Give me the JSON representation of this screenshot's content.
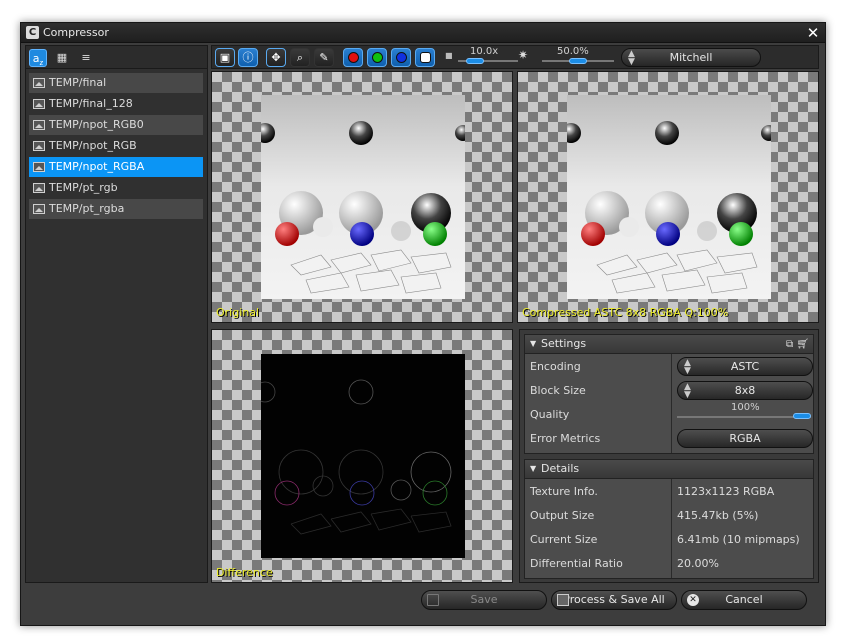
{
  "window": {
    "title": "Compressor",
    "app_icon": "app-icon",
    "close_icon": "close-icon"
  },
  "left_toolbar": {
    "icons": [
      "sort-alpha-icon",
      "calendar-icon",
      "filter-icon"
    ]
  },
  "files": [
    {
      "label": "TEMP/final",
      "selected": false
    },
    {
      "label": "TEMP/final_128",
      "selected": false
    },
    {
      "label": "TEMP/npot_RGB0",
      "selected": false
    },
    {
      "label": "TEMP/npot_RGB",
      "selected": false
    },
    {
      "label": "TEMP/npot_RGBA",
      "selected": true
    },
    {
      "label": "TEMP/pt_rgb",
      "selected": false
    },
    {
      "label": "TEMP/pt_rgba",
      "selected": false
    }
  ],
  "toolbar": {
    "zoom": {
      "label": "10.0x",
      "level": 0.2
    },
    "exposure": {
      "label": "50.0%",
      "level": 0.5
    },
    "filter": "Mitchell",
    "channel_colors": [
      "#e01010",
      "#10c010",
      "#1030e0",
      "#ffffff"
    ]
  },
  "panes": {
    "original": "Original",
    "compressed": "Compressed ASTC 8x8 RGBA Q:100%",
    "difference": "Difference"
  },
  "settings": {
    "header": "Settings",
    "encoding": {
      "label": "Encoding",
      "value": "ASTC"
    },
    "block_size": {
      "label": "Block Size",
      "value": "8x8"
    },
    "quality": {
      "label": "Quality",
      "value": "100%",
      "level": 1.0
    },
    "error_metrics": {
      "label": "Error Metrics",
      "value": "RGBA"
    }
  },
  "details": {
    "header": "Details",
    "rows": [
      {
        "label": "Texture Info.",
        "value": "1123x1123 RGBA"
      },
      {
        "label": "Output Size",
        "value": "415.47kb (5%)"
      },
      {
        "label": "Current Size",
        "value": "6.41mb (10 mipmaps)"
      },
      {
        "label": "Differential Ratio",
        "value": "20.00%"
      }
    ]
  },
  "buttons": {
    "save": "Save",
    "process_save_all": "Process & Save All",
    "cancel": "Cancel"
  }
}
